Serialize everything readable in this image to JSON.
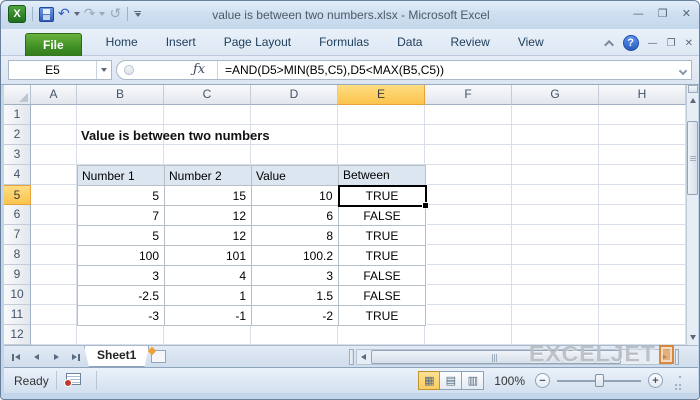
{
  "window": {
    "title": "value is between two numbers.xlsx  -  Microsoft Excel"
  },
  "quick_access": {
    "buttons": [
      "excel-app-icon",
      "save",
      "undo",
      "redo",
      "repeat",
      "customize-quick-access-toolbar"
    ]
  },
  "ribbon": {
    "tabs": [
      {
        "label": "File",
        "active": true
      },
      {
        "label": "Home"
      },
      {
        "label": "Insert"
      },
      {
        "label": "Page Layout"
      },
      {
        "label": "Formulas"
      },
      {
        "label": "Data"
      },
      {
        "label": "Review"
      },
      {
        "label": "View"
      }
    ],
    "right_controls": [
      "minimize-ribbon",
      "help",
      "minimize-workbook",
      "restore-workbook",
      "close-workbook"
    ]
  },
  "formula_bar": {
    "cell_reference": "E5",
    "fx_label": "ƒx",
    "formula": "=AND(D5>MIN(B5,C5),D5<MAX(B5,C5))"
  },
  "grid": {
    "column_headers": [
      "A",
      "B",
      "C",
      "D",
      "E",
      "F",
      "G",
      "H"
    ],
    "row_headers": [
      "1",
      "2",
      "3",
      "4",
      "5",
      "6",
      "7",
      "8",
      "9",
      "10",
      "11",
      "12"
    ],
    "selected_column": "E",
    "selected_row": "5",
    "heading_text": "Value is between two numbers",
    "table": {
      "headers": [
        "Number 1",
        "Number 2",
        "Value",
        "Between"
      ],
      "rows": [
        [
          "5",
          "15",
          "10",
          "TRUE"
        ],
        [
          "7",
          "12",
          "6",
          "FALSE"
        ],
        [
          "5",
          "12",
          "8",
          "TRUE"
        ],
        [
          "100",
          "101",
          "100.2",
          "TRUE"
        ],
        [
          "3",
          "4",
          "3",
          "FALSE"
        ],
        [
          "-2.5",
          "1",
          "1.5",
          "FALSE"
        ],
        [
          "-3",
          "-1",
          "-2",
          "TRUE"
        ]
      ],
      "selected_cell": {
        "reference": "E5",
        "row_index": 0,
        "col_index": 3,
        "value": "TRUE"
      }
    }
  },
  "sheet_bar": {
    "tabs": [
      {
        "label": "Sheet1",
        "active": true
      }
    ],
    "nav_icons": [
      "first-sheet",
      "previous-sheet",
      "next-sheet",
      "last-sheet"
    ],
    "insert_icon": "insert-worksheet"
  },
  "status_bar": {
    "mode": "Ready",
    "zoom_level": "100%",
    "view_buttons": [
      "normal-view",
      "page-layout-view",
      "page-break-preview"
    ],
    "active_view": "normal-view"
  },
  "watermark": {
    "text": "EXCELJET"
  },
  "colors": {
    "selection_amber": "#fbc34c",
    "file_tab_green": "#3f8f24",
    "table_header_fill": "#dce6f1",
    "help_blue": "#2a5fc0",
    "watermark_orange": "#e29646",
    "gridline": "#d9dfe8"
  }
}
